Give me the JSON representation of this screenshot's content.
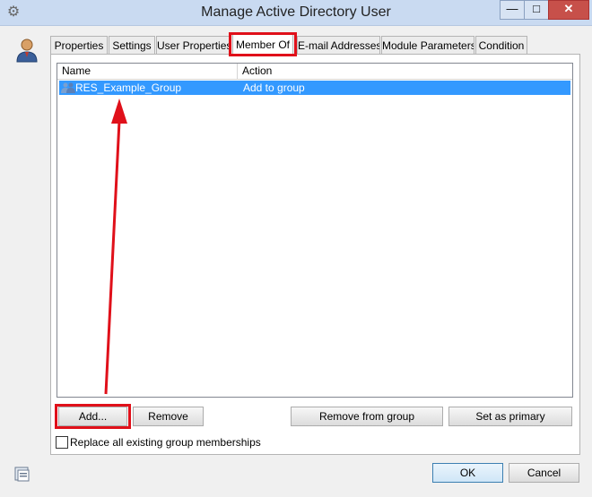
{
  "window": {
    "title": "Manage Active Directory User",
    "controls": {
      "minimize": "—",
      "maximize": "□",
      "close": "✕"
    }
  },
  "tabs": [
    {
      "label": "Properties"
    },
    {
      "label": "Settings"
    },
    {
      "label": "User Properties"
    },
    {
      "label": "Member Of",
      "active": true
    },
    {
      "label": "E-mail Addresses"
    },
    {
      "label": "Module Parameters"
    },
    {
      "label": "Condition"
    }
  ],
  "list": {
    "columns": {
      "name": "Name",
      "action": "Action"
    },
    "rows": [
      {
        "name": "RES_Example_Group",
        "action": "Add to group",
        "selected": true
      }
    ]
  },
  "buttons": {
    "add": "Add...",
    "remove": "Remove",
    "remove_from_group": "Remove from group",
    "set_as_primary": "Set as primary",
    "ok": "OK",
    "cancel": "Cancel"
  },
  "checkbox": {
    "label": "Replace all existing group memberships",
    "checked": false
  },
  "colors": {
    "highlight": "#e0101a",
    "selection": "#3399ff"
  },
  "icons": [
    "gear-icon",
    "user-avatar-icon",
    "group-icon",
    "module-icon"
  ]
}
